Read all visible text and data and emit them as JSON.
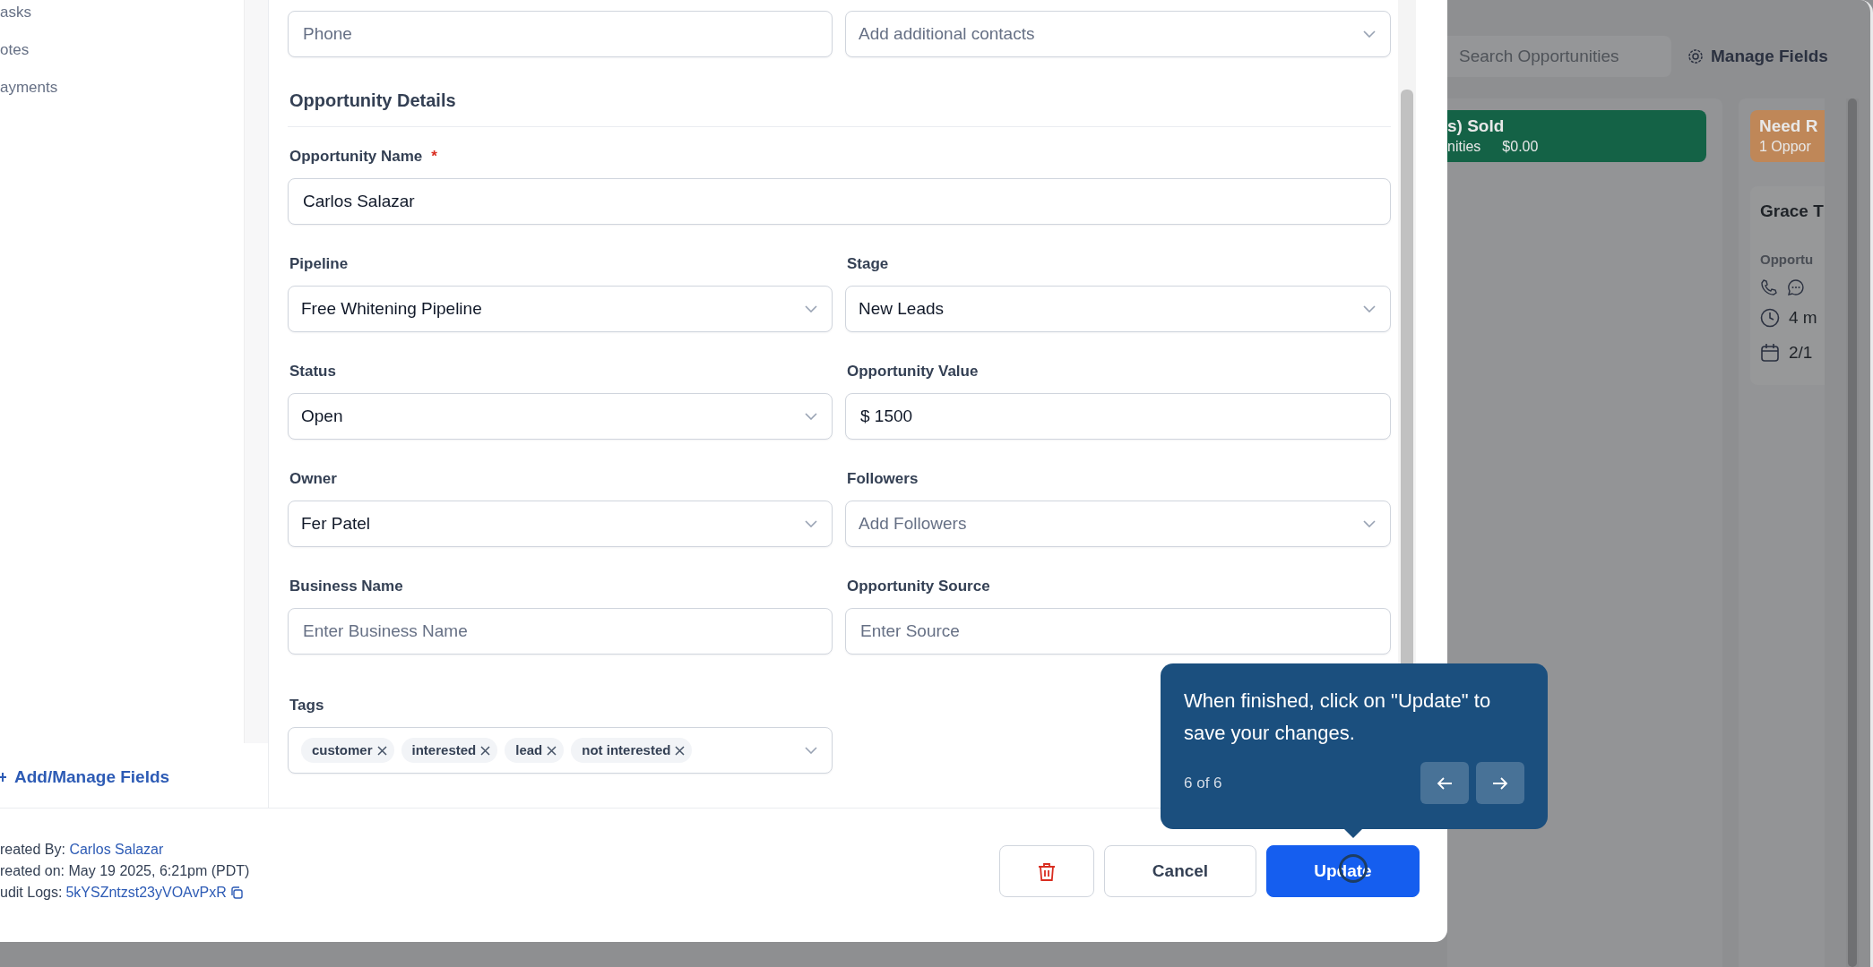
{
  "sidebar": {
    "items": [
      {
        "label": "asks"
      },
      {
        "label": "otes"
      },
      {
        "label": "ayments"
      }
    ],
    "manage_fields_link": "Add/Manage Fields"
  },
  "contact_fields": [
    {
      "kind": "text",
      "placeholder": "Phone"
    },
    {
      "kind": "select",
      "placeholder": "Add additional contacts"
    }
  ],
  "section_title": "Opportunity Details",
  "form_rows": [
    [
      {
        "kind": "text",
        "label": "Opportunity Name",
        "required_mark": "*",
        "value": "Carlos Salazar"
      }
    ],
    [
      {
        "kind": "select",
        "label": "Pipeline",
        "value": "Free Whitening Pipeline"
      },
      {
        "kind": "select",
        "label": "Stage",
        "value": "New Leads"
      }
    ],
    [
      {
        "kind": "select",
        "label": "Status",
        "value": "Open"
      },
      {
        "kind": "text",
        "label": "Opportunity Value",
        "value": "$ 1500"
      }
    ],
    [
      {
        "kind": "select",
        "label": "Owner",
        "value": "Fer Patel"
      },
      {
        "kind": "select",
        "label": "Followers",
        "placeholder": "Add Followers"
      }
    ],
    [
      {
        "kind": "text",
        "label": "Business Name",
        "placeholder": "Enter Business Name"
      },
      {
        "kind": "text",
        "label": "Opportunity Source",
        "placeholder": "Enter Source"
      }
    ],
    [
      {
        "kind": "tags",
        "label": "Tags",
        "tags": [
          "customer",
          "interested",
          "lead",
          "not interested"
        ]
      }
    ]
  ],
  "footer": {
    "created_by_label": "reated By:",
    "created_by": "Carlos Salazar",
    "created_on": "reated on: May 19 2025, 6:21pm (PDT)",
    "audit_label": "udit Logs:",
    "audit_id": "5kYSZntzst23yVOAvPxR",
    "buttons": [
      {
        "kind": "delete"
      },
      {
        "kind": "secondary",
        "label": "Cancel"
      },
      {
        "kind": "primary",
        "label": "Update"
      }
    ]
  },
  "tooltip": {
    "text": "When finished, click on \"Update\" to save your changes.",
    "step": "6 of 6"
  },
  "background": {
    "search": {
      "placeholder": "Search Opportunities"
    },
    "manage_fields": "Manage Fields",
    "columns": [
      {
        "title": "s) Sold",
        "count": "nities",
        "value": "$0.00",
        "color": "#146246"
      },
      {
        "title": "Need R",
        "count": "1 Oppor",
        "color": "#bf8758",
        "cards": [
          {
            "name": "Grace T",
            "label": "Opportu",
            "time": "4 m",
            "date": "2/1"
          }
        ]
      }
    ]
  }
}
